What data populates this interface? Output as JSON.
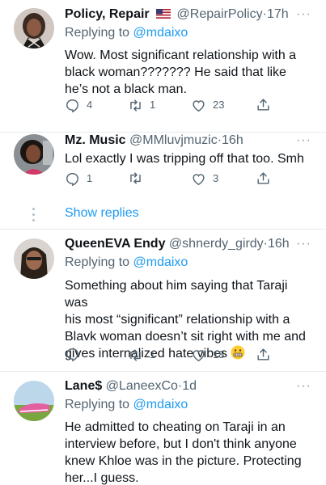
{
  "tweets": [
    {
      "name": "Policy, Repair",
      "flag": "us-flag",
      "handle": "@RepairPolicy",
      "time": "17h",
      "replying_label": "Replying to",
      "replying_to": "@mdaixo",
      "text": "Wow. Most significant relationship with a black woman??????? He said that like he’s not a black man.",
      "replies": "4",
      "retweets": "1",
      "likes": "23"
    },
    {
      "name": "Mz. Music",
      "handle": "@MMluvjmuzic",
      "time": "16h",
      "text": "Lol exactly I was tripping off that too. Smh",
      "replies": "1",
      "retweets": "",
      "likes": "3"
    },
    {
      "name": "QueenEVA Endy",
      "handle": "@shnerdy_girdy",
      "time": "16h",
      "replying_label": "Replying to",
      "replying_to": "@mdaixo",
      "text_lines": [
        "Something about him saying that Taraji was",
        "his most “significant” relationship with a",
        "Blavk woman doesn’t sit right with me and",
        "gives internalized hate vibes"
      ],
      "emoji": "grimacing-face-emoji",
      "replies": "",
      "retweets": "1",
      "likes": "18"
    },
    {
      "name": "Lane$",
      "handle": "@LaneexCo",
      "time": "1d",
      "replying_label": "Replying to",
      "replying_to": "@mdaixo",
      "text": "He admitted to cheating on Taraji in an interview before, but I don't think anyone knew Khloe was in the picture. Protecting her...I guess."
    }
  ],
  "show_replies": "Show replies",
  "more_glyph": "···",
  "dot_sep": "·",
  "colors": {
    "link": "#1d9bf0",
    "secondary": "#536471",
    "divider": "#e6ecf0"
  }
}
